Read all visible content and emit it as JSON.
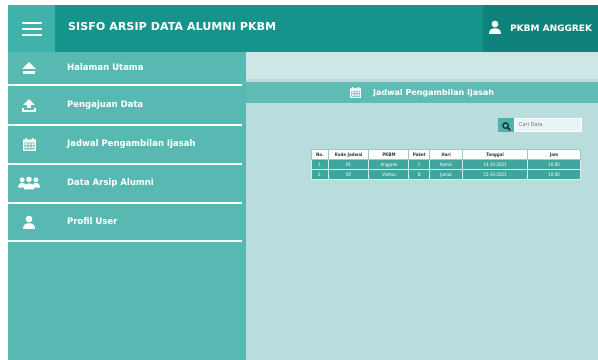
{
  "app": {
    "title": "SISFO ARSIP DATA ALUMNI PKBM"
  },
  "user": {
    "name": "PKBM ANGGREK"
  },
  "sidebar": {
    "items": [
      {
        "label": "Halaman Utama",
        "icon": "home-icon"
      },
      {
        "label": "Pengajuan Data",
        "icon": "upload-icon"
      },
      {
        "label": "Jadwal Pengambilan Ijasah",
        "icon": "calendar-icon"
      },
      {
        "label": "Data Arsip Alumni",
        "icon": "group-icon"
      },
      {
        "label": "Profil User",
        "icon": "user-icon"
      }
    ]
  },
  "content": {
    "title": "Jadwal Pengambilan Ijasah",
    "search": {
      "placeholder": "Cari Data"
    },
    "table": {
      "headers": [
        "No.",
        "Kode Jadwal",
        "PKBM",
        "Paket",
        "Hari",
        "Tanggal",
        "Jam"
      ],
      "rows": [
        [
          "1.",
          "91",
          "Anggrek",
          "C",
          "Kamis",
          "14-10-2021",
          "10.00"
        ],
        [
          "2.",
          "92",
          "Vishnu",
          "B",
          "Jumat",
          "15-10-2021",
          "10.00"
        ]
      ]
    }
  },
  "colors": {
    "topbar": "#16948c",
    "sidebar": "#58b8b2",
    "main_bg": "#b9dcdc",
    "content_header": "#5ebcb5",
    "table_row": "#3fa59e"
  }
}
